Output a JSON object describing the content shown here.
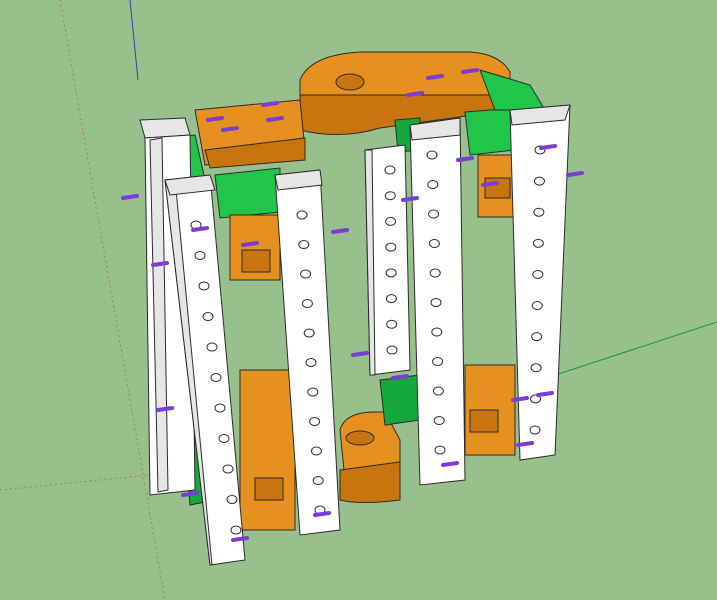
{
  "viewport": {
    "background": "#98c08c"
  },
  "colors": {
    "bar_face": "#ffffff",
    "bar_side": "#e6e6e6",
    "bar_edge": "#2b2b2b",
    "bracket_green": "#1fc64a",
    "bracket_green_dark": "#16a83c",
    "orange_plate": "#e6901f",
    "orange_plate_dark": "#c87510",
    "bolt_purple": "#7a3dd6",
    "hole": "#ffffff",
    "axis_red": "#c0392b",
    "axis_green": "#1f9a2a",
    "axis_blue": "#2f3cc0"
  },
  "icons": {
    "model": "3d-tower-frame-model",
    "axes": "axis-guides"
  }
}
